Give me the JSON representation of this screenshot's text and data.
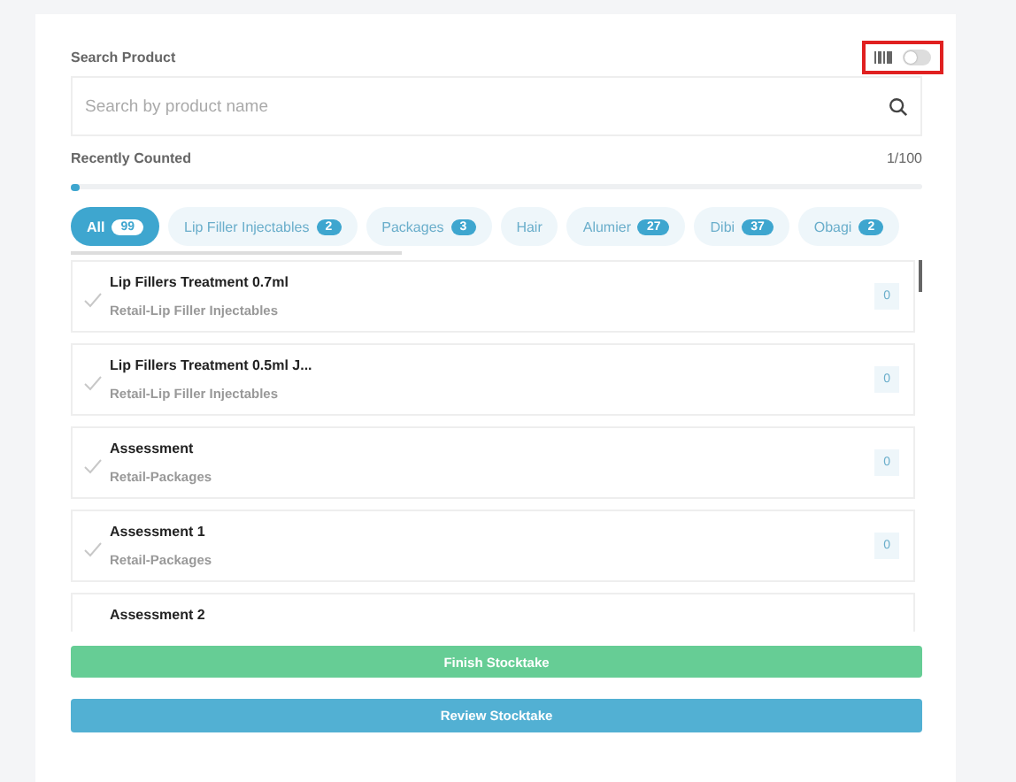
{
  "search": {
    "label": "Search Product",
    "placeholder": "Search by product name",
    "barcode_toggle": {
      "on": false,
      "highlighted": true
    }
  },
  "progress": {
    "label": "Recently Counted",
    "reading": "1/100",
    "level": 0.01
  },
  "categories": [
    {
      "label": "All",
      "count": "99",
      "selected": true
    },
    {
      "label": "Lip Filler Injectables",
      "count": "2",
      "selected": false
    },
    {
      "label": "Packages",
      "count": "3",
      "selected": false
    },
    {
      "label": "Hair",
      "selected": false
    },
    {
      "label": "Alumier",
      "count": "27",
      "selected": false
    },
    {
      "label": "Dibi",
      "count": "37",
      "selected": false
    },
    {
      "label": "Obagi",
      "count": "2",
      "selected": false
    }
  ],
  "products": [
    {
      "name": "Lip Fillers Treatment 0.7ml",
      "category": "Retail-Lip Filler Injectables",
      "count": "0",
      "counted": false
    },
    {
      "name": "Lip Fillers Treatment 0.5ml J...",
      "category": "Retail-Lip Filler Injectables",
      "count": "0",
      "counted": false
    },
    {
      "name": "Assessment",
      "category": "Retail-Packages",
      "count": "0",
      "counted": false
    },
    {
      "name": "Assessment 1",
      "category": "Retail-Packages",
      "count": "0",
      "counted": false
    },
    {
      "name": "Assessment 2"
    }
  ],
  "buttons": [
    {
      "label": "Finish Stocktake",
      "kind": "finish"
    },
    {
      "label": "Review Stocktake",
      "kind": "review"
    }
  ]
}
